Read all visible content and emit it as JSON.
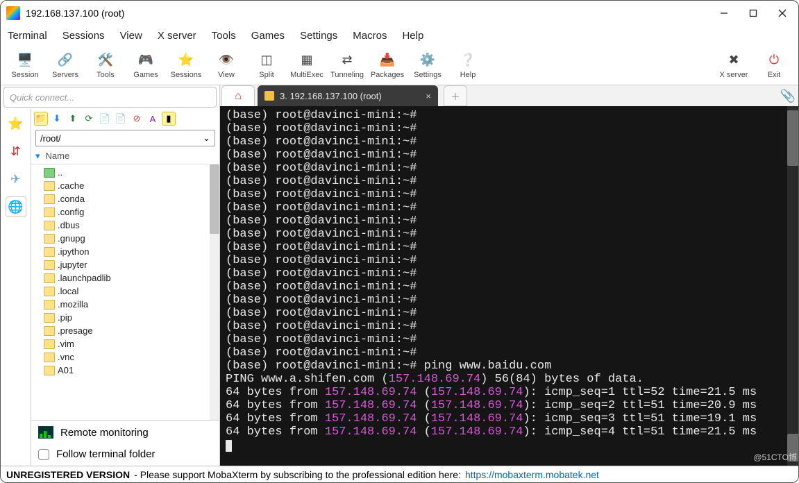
{
  "window": {
    "title": "192.168.137.100 (root)"
  },
  "menubar": [
    "Terminal",
    "Sessions",
    "View",
    "X server",
    "Tools",
    "Games",
    "Settings",
    "Macros",
    "Help"
  ],
  "toolbar": [
    {
      "label": "Session",
      "icon": "🖥️"
    },
    {
      "label": "Servers",
      "icon": "🔗"
    },
    {
      "label": "Tools",
      "icon": "🛠️"
    },
    {
      "label": "Games",
      "icon": "🎮"
    },
    {
      "label": "Sessions",
      "icon": "⭐"
    },
    {
      "label": "View",
      "icon": "👁️"
    },
    {
      "label": "Split",
      "icon": "◫"
    },
    {
      "label": "MultiExec",
      "icon": "▦"
    },
    {
      "label": "Tunneling",
      "icon": "⇄"
    },
    {
      "label": "Packages",
      "icon": "📥"
    },
    {
      "label": "Settings",
      "icon": "⚙️"
    },
    {
      "label": "Help",
      "icon": "❔"
    }
  ],
  "toolbar_right": [
    {
      "label": "X server",
      "icon": "✖",
      "class": ""
    },
    {
      "label": "Exit",
      "icon": "⏻",
      "class": "exit"
    }
  ],
  "quick_connect_placeholder": "Quick connect...",
  "sidebar_path": "/root/",
  "tree_header": "Name",
  "tree": [
    {
      "name": "..",
      "up": true
    },
    {
      "name": ".cache"
    },
    {
      "name": ".conda"
    },
    {
      "name": ".config"
    },
    {
      "name": ".dbus"
    },
    {
      "name": ".gnupg"
    },
    {
      "name": ".ipython"
    },
    {
      "name": ".jupyter"
    },
    {
      "name": ".launchpadlib"
    },
    {
      "name": ".local"
    },
    {
      "name": ".mozilla"
    },
    {
      "name": ".pip"
    },
    {
      "name": ".presage"
    },
    {
      "name": ".vim"
    },
    {
      "name": ".vnc"
    },
    {
      "name": "A01"
    }
  ],
  "remote_monitoring": "Remote monitoring",
  "follow_terminal": "Follow terminal folder",
  "tab_label": "3. 192.168.137.100 (root)",
  "terminal": {
    "prompt": "(base) root@davinci-mini:~#",
    "prompt_count": 19,
    "cmd_line": "(base) root@davinci-mini:~# ping www.baidu.com",
    "ping_header_pre": "PING www.a.shifen.com (",
    "ping_header_ip": "157.148.69.74",
    "ping_header_post": ") 56(84) bytes of data.",
    "lines": [
      {
        "seq": 1,
        "ttl": 52,
        "time": "21.5"
      },
      {
        "seq": 2,
        "ttl": 51,
        "time": "20.9"
      },
      {
        "seq": 3,
        "ttl": 51,
        "time": "19.1"
      },
      {
        "seq": 4,
        "ttl": 51,
        "time": "21.5"
      }
    ],
    "ip": "157.148.69.74"
  },
  "status": {
    "unreg": "UNREGISTERED VERSION",
    "msg": " -  Please support MobaXterm by subscribing to the professional edition here:  ",
    "link": "https://mobaxterm.mobatek.net"
  },
  "watermark": "@51CTO博"
}
